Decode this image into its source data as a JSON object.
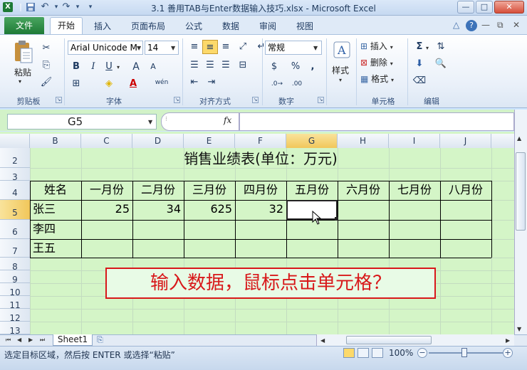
{
  "window": {
    "title": "3.1 善用TAB与Enter数据输入技巧.xlsx - Microsoft Excel",
    "min_label": "—",
    "max_label": "□",
    "close_label": "✕",
    "quickaccess": [
      "save-icon",
      "undo-icon",
      "redo-icon",
      "customize-icon"
    ]
  },
  "tabs": {
    "file": "文件",
    "items": [
      "开始",
      "插入",
      "页面布局",
      "公式",
      "数据",
      "审阅",
      "视图"
    ],
    "active": "开始"
  },
  "ribbon": {
    "clipboard": {
      "paste": "粘贴",
      "label": "剪贴板"
    },
    "font": {
      "name": "Arial Unicode M",
      "size": "14",
      "label": "字体",
      "bold": "B",
      "italic": "I",
      "underline": "U",
      "grow": "A",
      "shrink": "A",
      "color_a": "A",
      "wen": "wén"
    },
    "alignment": {
      "label": "对齐方式"
    },
    "number": {
      "format": "常规",
      "label": "数字",
      "percent": "%",
      "comma": ","
    },
    "styles": {
      "label": "样式"
    },
    "cells": {
      "insert": "插入",
      "delete": "删除",
      "format": "格式",
      "label": "单元格"
    },
    "editing": {
      "sum": "Σ",
      "label": "编辑"
    }
  },
  "formula_bar": {
    "name_box": "G5",
    "fx": "fx",
    "content": ""
  },
  "columns": [
    "B",
    "C",
    "D",
    "E",
    "F",
    "G",
    "H",
    "I",
    "J"
  ],
  "selected_column": "G",
  "rows": [
    "2",
    "3",
    "4",
    "5",
    "6",
    "7",
    "8",
    "9",
    "10",
    "11",
    "12",
    "13"
  ],
  "selected_row": "5",
  "sheet": {
    "title": "销售业绩表(单位：万元)",
    "headers": [
      "姓名",
      "一月份",
      "二月份",
      "三月份",
      "四月份",
      "五月份",
      "六月份",
      "七月份",
      "八月份"
    ],
    "data": [
      [
        "张三",
        "25",
        "34",
        "625",
        "32",
        "",
        "",
        "",
        ""
      ],
      [
        "李四",
        "",
        "",
        "",
        "",
        "",
        "",
        "",
        ""
      ],
      [
        "王五",
        "",
        "",
        "",
        "",
        "",
        "",
        "",
        ""
      ]
    ],
    "banner": "输入数据，鼠标点击单元格？"
  },
  "sheet_tabs": {
    "active": "Sheet1"
  },
  "status": {
    "text": "选定目标区域，然后按 ENTER 或选择“粘贴”",
    "zoom": "100%"
  },
  "colors": {
    "banner_red": "#d8181a",
    "sheet_bg": "#d4f5c7",
    "file_tab": "#2e8b45"
  }
}
